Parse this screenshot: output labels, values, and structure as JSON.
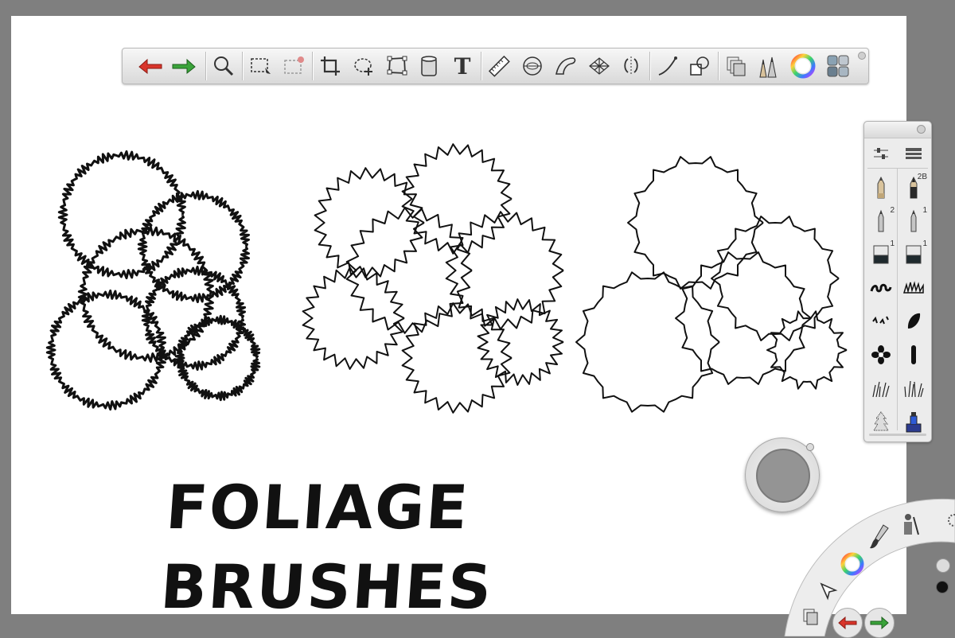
{
  "canvas": {
    "headline": "FOLIAGE BRUSHES",
    "background": "#ffffff",
    "workspace_background": "#7f7f7f"
  },
  "toolbar": {
    "tools": [
      "undo-icon",
      "redo-icon",
      "zoom-icon",
      "select-icon",
      "transform-selection-icon",
      "crop-icon",
      "lasso-icon",
      "distort-icon",
      "fill-icon",
      "text-icon",
      "ruler-icon",
      "ellipse-guide-icon",
      "french-curve-icon",
      "perspective-icon",
      "symmetry-icon",
      "stroke-tool-icon",
      "shape-icon",
      "layers-icon",
      "brush-library-icon",
      "color-wheel-icon",
      "copic-palette-icon"
    ],
    "text_tool_label": "T"
  },
  "brush_palette": {
    "badges": {
      "pencil_2b": "2B",
      "ballpoint_2": "2",
      "ballpoint_1": "1",
      "marker_1a": "1",
      "marker_1b": "1"
    },
    "brushes": [
      "pencil",
      "pencil-2B",
      "ballpoint-pen-2",
      "ballpoint-pen-1",
      "marker-1",
      "marker-1",
      "curly-foliage",
      "spiky-foliage",
      "tick-foliage",
      "leaf",
      "flower",
      "stroke",
      "grass",
      "grass-tall",
      "pine-tree",
      "ink-bottle"
    ]
  },
  "color_puck": {
    "color": "#949494"
  },
  "lagoon": {
    "items": [
      "layers-icon",
      "select-icon",
      "color-wheel-icon",
      "brush-icon",
      "library-icon",
      "settings-icon",
      "undo-icon",
      "redo-icon"
    ]
  },
  "colors": {
    "undo": "#d9352b",
    "redo": "#3aa33a",
    "stroke": "#111111"
  }
}
